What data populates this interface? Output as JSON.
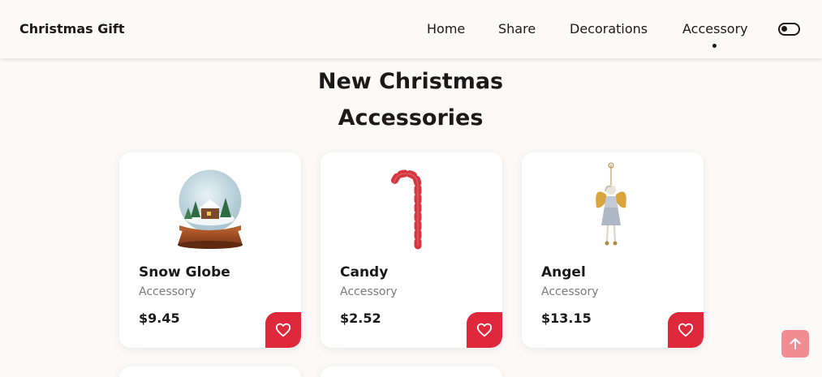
{
  "header": {
    "logo": "Christmas Gift",
    "nav": [
      {
        "label": "Home"
      },
      {
        "label": "Share"
      },
      {
        "label": "Decorations"
      },
      {
        "label": "Accessory",
        "active": true
      }
    ],
    "theme_toggle_icon": "toggle-icon"
  },
  "section": {
    "title_line1": "New Christmas",
    "title_line2": "Accessories"
  },
  "products": [
    {
      "name": "Snow Globe",
      "category": "Accessory",
      "price": "$9.45",
      "image_icon": "snow-globe-icon"
    },
    {
      "name": "Candy",
      "category": "Accessory",
      "price": "$2.52",
      "image_icon": "candy-cane-icon"
    },
    {
      "name": "Angel",
      "category": "Accessory",
      "price": "$13.15",
      "image_icon": "angel-ornament-icon"
    }
  ],
  "colors": {
    "accent": "#e0283c",
    "scroll_top": "#f08c92",
    "background": "#fcfaf9"
  }
}
